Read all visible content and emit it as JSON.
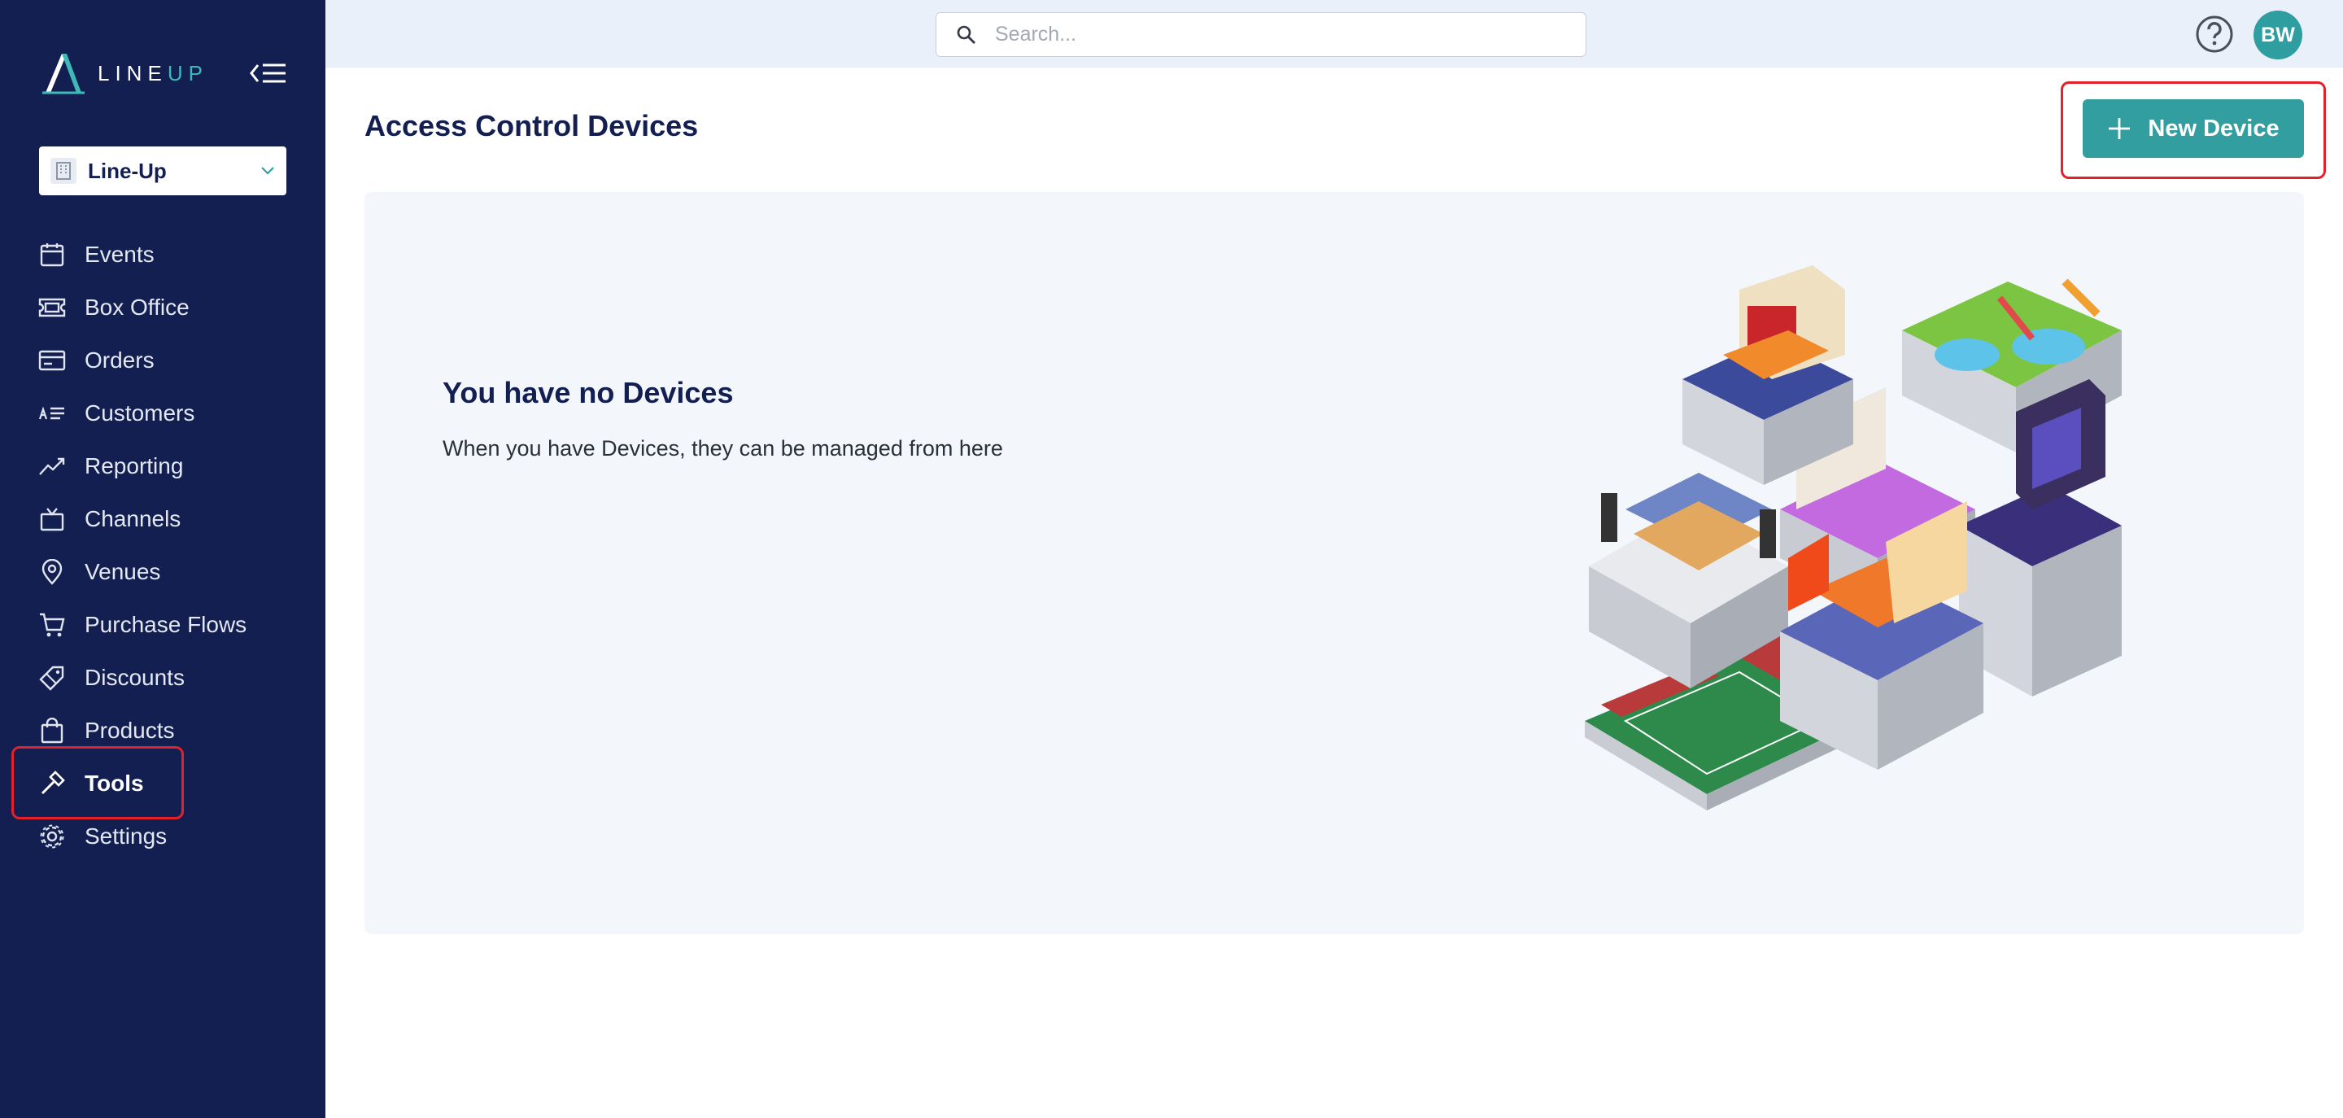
{
  "brand": {
    "logo_text_main": "LINE",
    "logo_text_accent": "UP"
  },
  "org_selector": {
    "selected": "Line-Up"
  },
  "sidebar": {
    "items": [
      {
        "label": "Events",
        "icon": "calendar-icon"
      },
      {
        "label": "Box Office",
        "icon": "ticket-icon"
      },
      {
        "label": "Orders",
        "icon": "credit-card-icon"
      },
      {
        "label": "Customers",
        "icon": "customers-list-icon"
      },
      {
        "label": "Reporting",
        "icon": "trend-chart-icon"
      },
      {
        "label": "Channels",
        "icon": "tv-icon"
      },
      {
        "label": "Venues",
        "icon": "map-pin-icon"
      },
      {
        "label": "Purchase Flows",
        "icon": "cart-icon"
      },
      {
        "label": "Discounts",
        "icon": "tags-icon"
      },
      {
        "label": "Products",
        "icon": "shopping-bag-icon"
      },
      {
        "label": "Tools",
        "icon": "hammer-icon",
        "active": true
      },
      {
        "label": "Settings",
        "icon": "gear-icon"
      }
    ]
  },
  "header": {
    "search_placeholder": "Search...",
    "avatar_initials": "BW"
  },
  "main": {
    "title": "Access Control Devices",
    "new_button_label": "New Device",
    "empty_state": {
      "title": "You have no Devices",
      "description": "When you have Devices, they can be managed from here"
    }
  },
  "colors": {
    "sidebar_bg": "#121f50",
    "accent": "#339ea0",
    "highlight": "#e2212a",
    "card_bg": "#f3f6fb"
  }
}
